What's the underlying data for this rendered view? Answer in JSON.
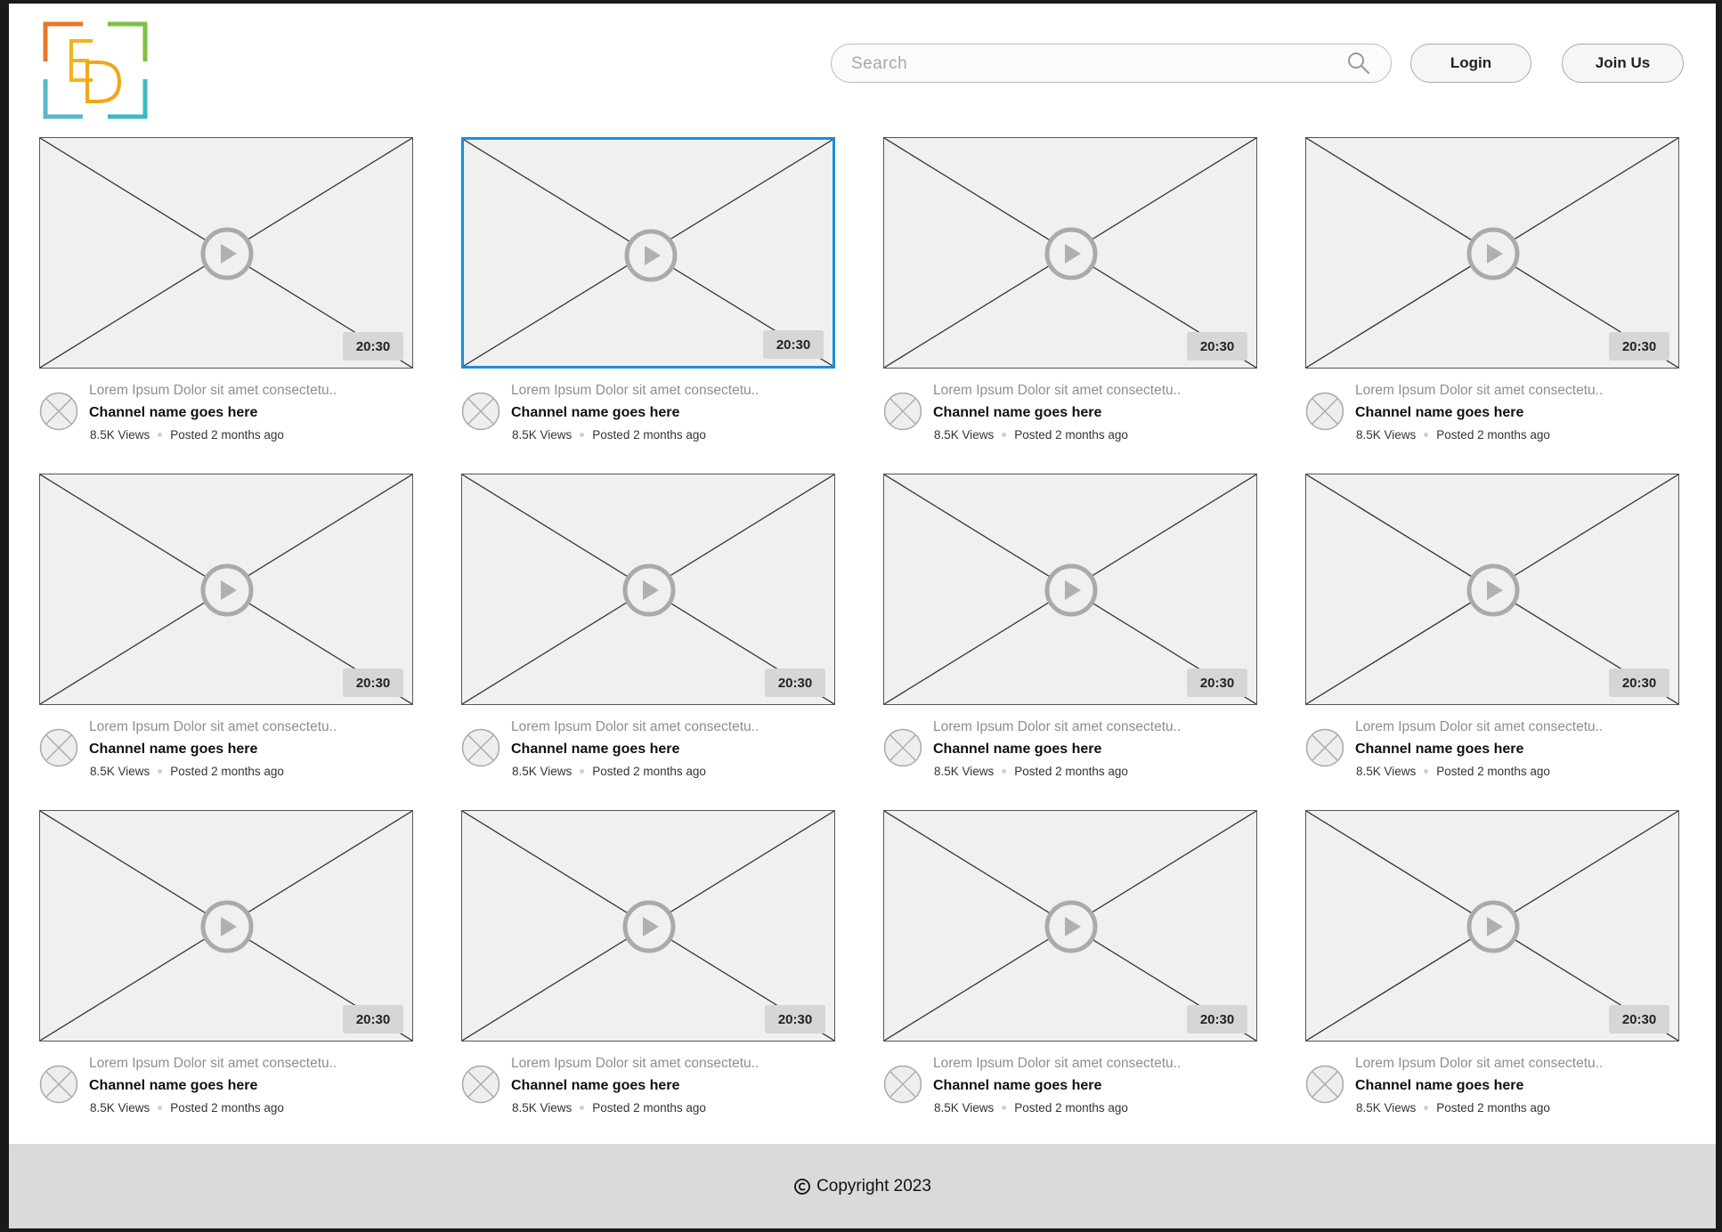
{
  "header": {
    "search_placeholder": "Search",
    "login_label": "Login",
    "join_label": "Join Us"
  },
  "videos": [
    {
      "duration": "20:30",
      "title": "Lorem Ipsum Dolor sit amet consectetu..",
      "channel": "Channel name goes here",
      "views": "8.5K Views",
      "posted": "Posted 2 months ago",
      "selected": false
    },
    {
      "duration": "20:30",
      "title": "Lorem Ipsum Dolor sit amet consectetu..",
      "channel": "Channel name goes here",
      "views": "8.5K Views",
      "posted": "Posted 2 months ago",
      "selected": true
    },
    {
      "duration": "20:30",
      "title": "Lorem Ipsum Dolor sit amet consectetu..",
      "channel": "Channel name goes here",
      "views": "8.5K Views",
      "posted": "Posted 2 months ago",
      "selected": false
    },
    {
      "duration": "20:30",
      "title": "Lorem Ipsum Dolor sit amet consectetu..",
      "channel": "Channel name goes here",
      "views": "8.5K Views",
      "posted": "Posted 2 months ago",
      "selected": false
    },
    {
      "duration": "20:30",
      "title": "Lorem Ipsum Dolor sit amet consectetu..",
      "channel": "Channel name goes here",
      "views": "8.5K Views",
      "posted": "Posted 2 months ago",
      "selected": false
    },
    {
      "duration": "20:30",
      "title": "Lorem Ipsum Dolor sit amet consectetu..",
      "channel": "Channel name goes here",
      "views": "8.5K Views",
      "posted": "Posted 2 months ago",
      "selected": false
    },
    {
      "duration": "20:30",
      "title": "Lorem Ipsum Dolor sit amet consectetu..",
      "channel": "Channel name goes here",
      "views": "8.5K Views",
      "posted": "Posted 2 months ago",
      "selected": false
    },
    {
      "duration": "20:30",
      "title": "Lorem Ipsum Dolor sit amet consectetu..",
      "channel": "Channel name goes here",
      "views": "8.5K Views",
      "posted": "Posted 2 months ago",
      "selected": false
    },
    {
      "duration": "20:30",
      "title": "Lorem Ipsum Dolor sit amet consectetu..",
      "channel": "Channel name goes here",
      "views": "8.5K Views",
      "posted": "Posted 2 months ago",
      "selected": false
    },
    {
      "duration": "20:30",
      "title": "Lorem Ipsum Dolor sit amet consectetu..",
      "channel": "Channel name goes here",
      "views": "8.5K Views",
      "posted": "Posted 2 months ago",
      "selected": false
    },
    {
      "duration": "20:30",
      "title": "Lorem Ipsum Dolor sit amet consectetu..",
      "channel": "Channel name goes here",
      "views": "8.5K Views",
      "posted": "Posted 2 months ago",
      "selected": false
    },
    {
      "duration": "20:30",
      "title": "Lorem Ipsum Dolor sit amet consectetu..",
      "channel": "Channel name goes here",
      "views": "8.5K Views",
      "posted": "Posted 2 months ago",
      "selected": false
    }
  ],
  "footer": {
    "copyright": "Copyright 2023"
  },
  "colors": {
    "selected_border": "#1a8ee0",
    "logo_orange": "#e8782a",
    "logo_yellow": "#f2b320",
    "logo_green": "#7cc242",
    "logo_teal": "#3db8c4"
  }
}
